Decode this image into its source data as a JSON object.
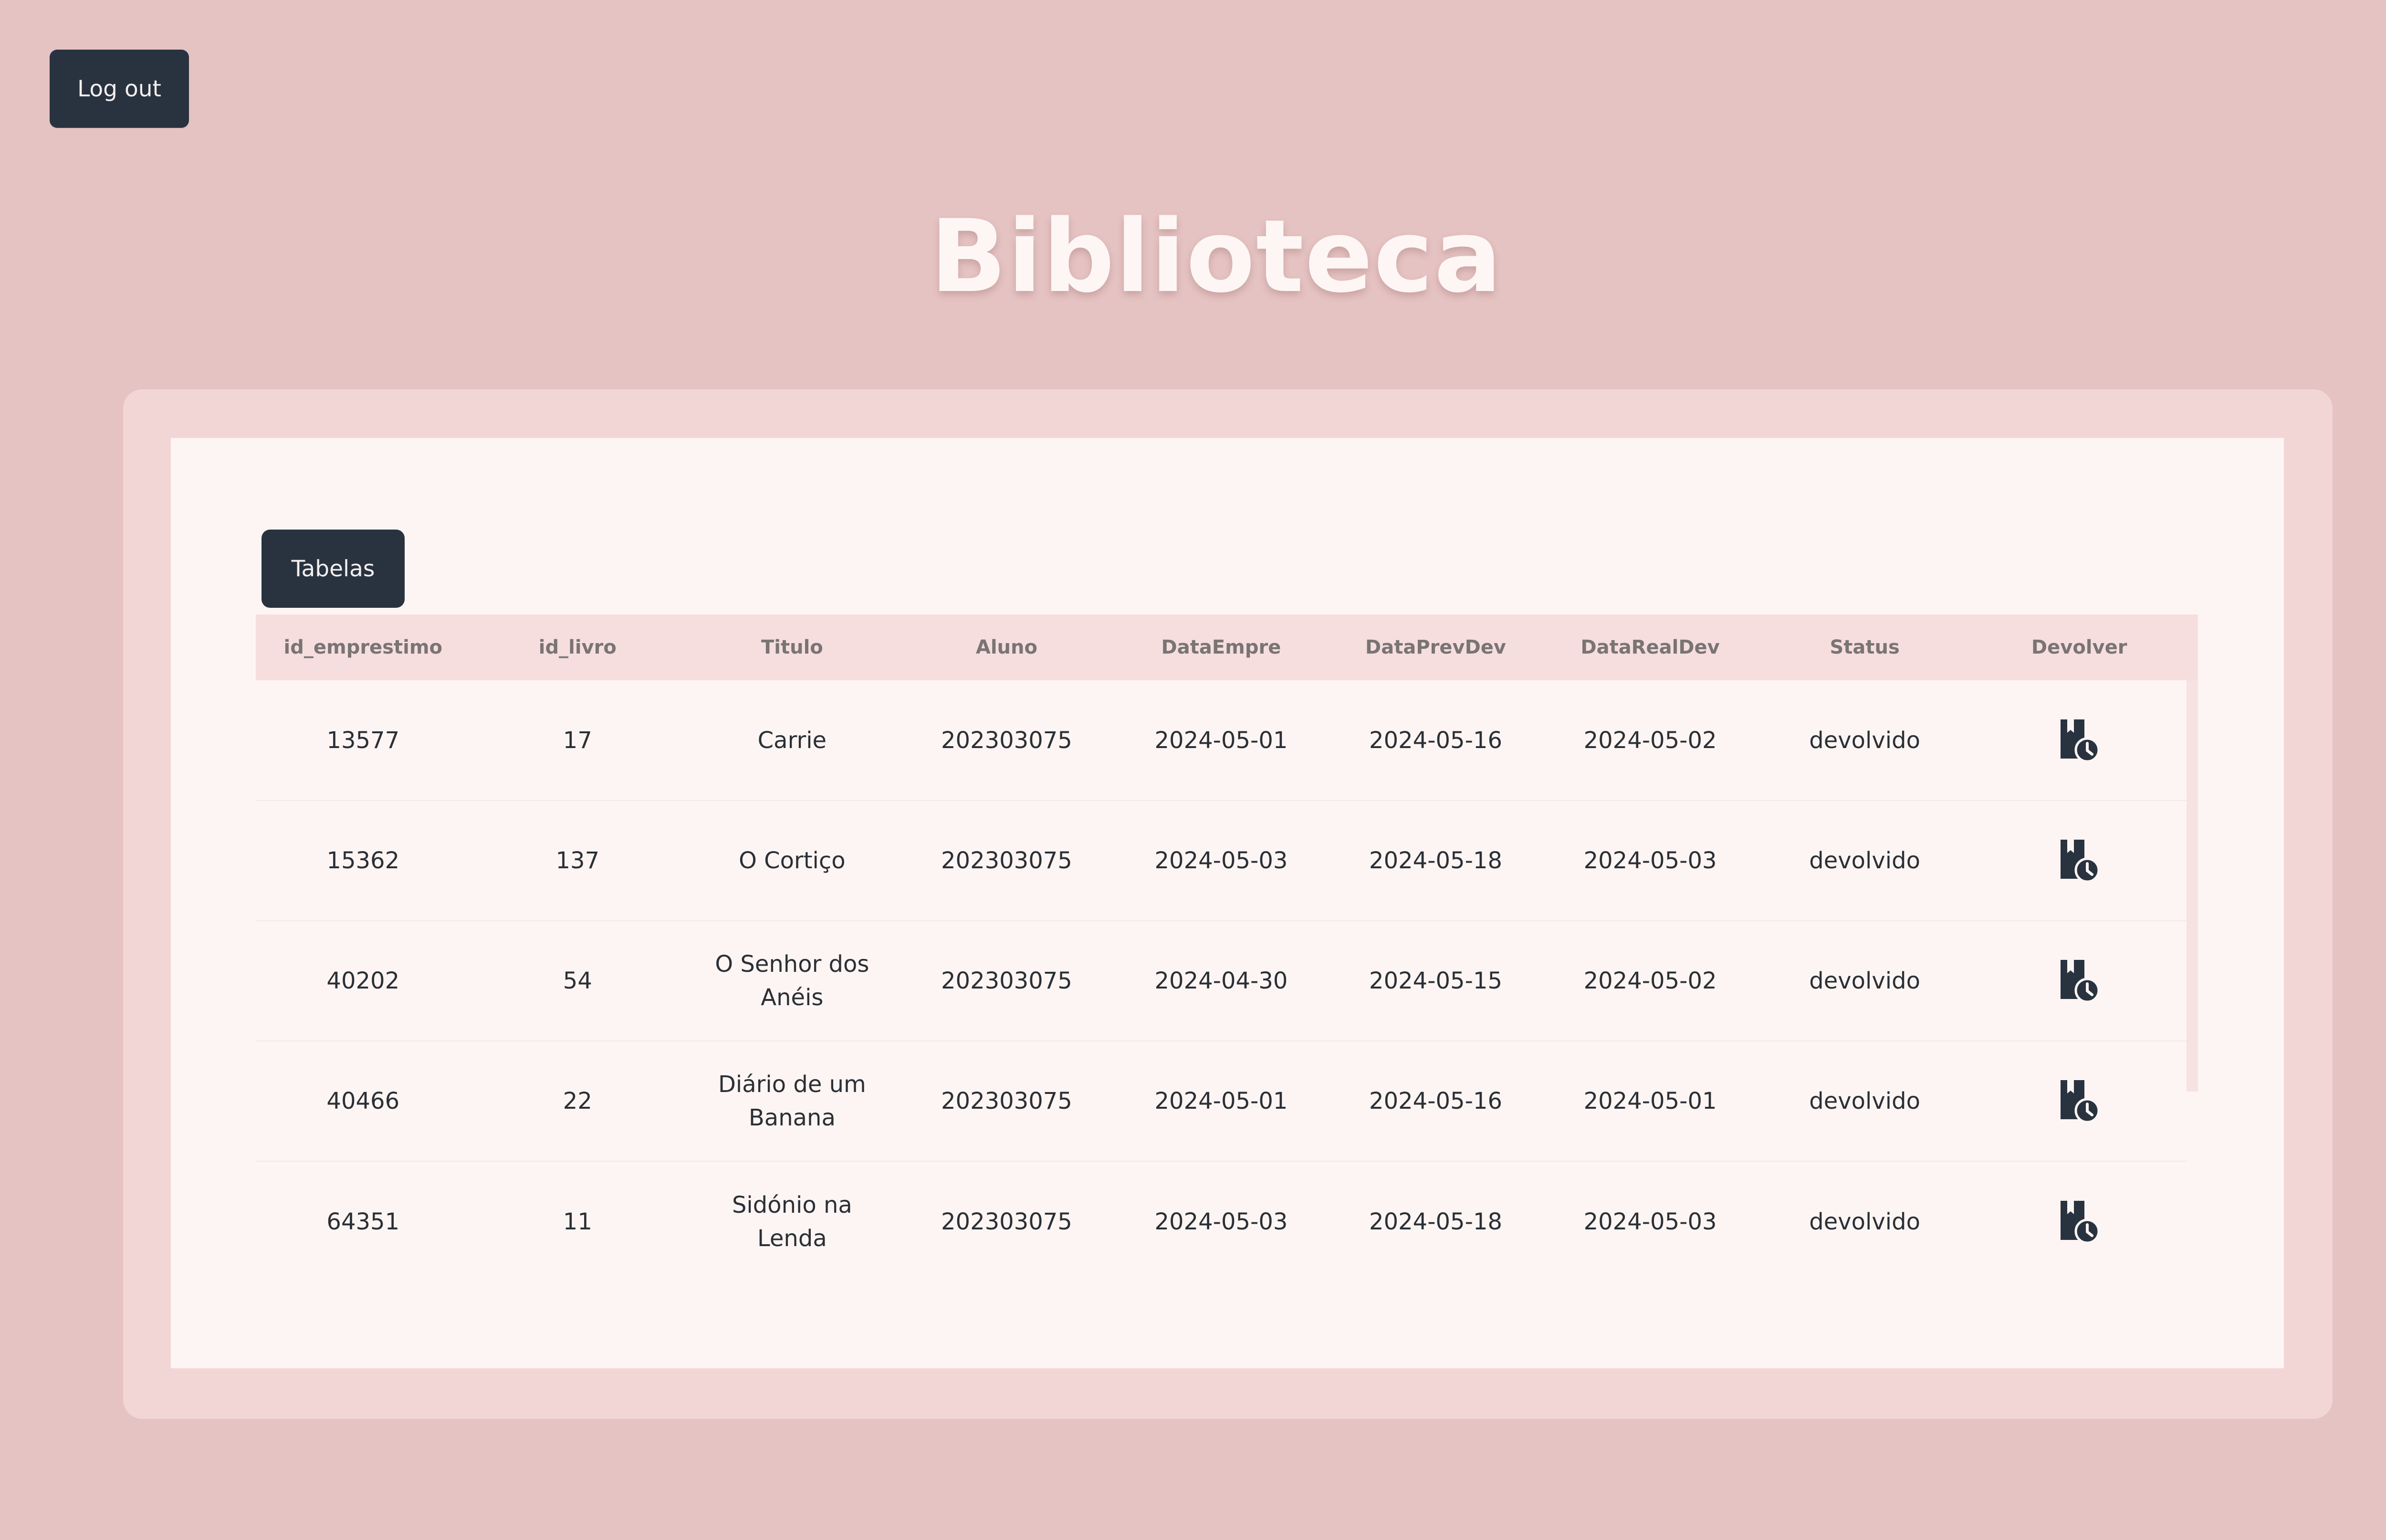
{
  "header": {
    "logout_label": "Log out",
    "title": "Biblioteca"
  },
  "panel": {
    "tabs_label": "Tabelas"
  },
  "table": {
    "columns": [
      "id_emprestimo",
      "id_livro",
      "Titulo",
      "Aluno",
      "DataEmpre",
      "DataPrevDev",
      "DataRealDev",
      "Status",
      "Devolver"
    ],
    "rows": [
      {
        "id_emprestimo": "13577",
        "id_livro": "17",
        "titulo": "Carrie",
        "aluno": "202303075",
        "data_empre": "2024-05-01",
        "data_prev_dev": "2024-05-16",
        "data_real_dev": "2024-05-02",
        "status": "devolvido",
        "action_icon": "book-clock-icon"
      },
      {
        "id_emprestimo": "15362",
        "id_livro": "137",
        "titulo": "O Cortiço",
        "aluno": "202303075",
        "data_empre": "2024-05-03",
        "data_prev_dev": "2024-05-18",
        "data_real_dev": "2024-05-03",
        "status": "devolvido",
        "action_icon": "book-clock-icon"
      },
      {
        "id_emprestimo": "40202",
        "id_livro": "54",
        "titulo": "O Senhor dos Anéis",
        "aluno": "202303075",
        "data_empre": "2024-04-30",
        "data_prev_dev": "2024-05-15",
        "data_real_dev": "2024-05-02",
        "status": "devolvido",
        "action_icon": "book-clock-icon"
      },
      {
        "id_emprestimo": "40466",
        "id_livro": "22",
        "titulo": "Diário de um Banana",
        "aluno": "202303075",
        "data_empre": "2024-05-01",
        "data_prev_dev": "2024-05-16",
        "data_real_dev": "2024-05-01",
        "status": "devolvido",
        "action_icon": "book-clock-icon"
      },
      {
        "id_emprestimo": "64351",
        "id_livro": "11",
        "titulo": "Sidónio na Lenda",
        "aluno": "202303075",
        "data_empre": "2024-05-03",
        "data_prev_dev": "2024-05-18",
        "data_real_dev": "2024-05-03",
        "status": "devolvido",
        "action_icon": "book-clock-icon"
      }
    ]
  },
  "colors": {
    "background": "#e5c3c2",
    "panel": "#f2d6d6",
    "card": "#fdf5f3",
    "button": "#293340",
    "header_row": "#f6dede"
  }
}
